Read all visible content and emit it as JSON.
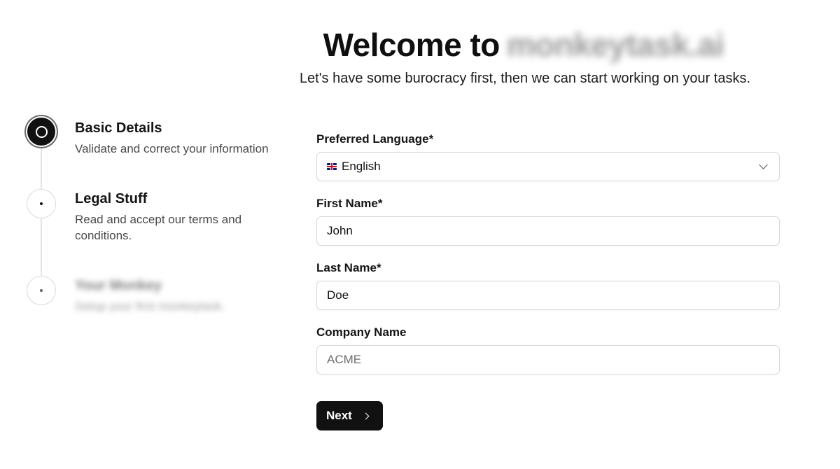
{
  "header": {
    "title_prefix": "Welcome to",
    "title_brand": "monkeytask.ai",
    "subtitle": "Let's have some burocracy first, then we can start working on your tasks."
  },
  "steps": [
    {
      "title": "Basic Details",
      "description": "Validate and correct your information",
      "state": "active"
    },
    {
      "title": "Legal Stuff",
      "description": "Read and accept our terms and conditions.",
      "state": "upcoming"
    },
    {
      "title": "Your Monkey",
      "description": "Setup your first monkeytask.",
      "state": "upcoming"
    }
  ],
  "form": {
    "language": {
      "label": "Preferred Language*",
      "value": "English",
      "flag": "uk-flag-icon"
    },
    "first_name": {
      "label": "First Name*",
      "value": "John"
    },
    "last_name": {
      "label": "Last Name*",
      "value": "Doe"
    },
    "company": {
      "label": "Company Name",
      "value": "",
      "placeholder": "ACME"
    }
  },
  "actions": {
    "next_label": "Next"
  },
  "colors": {
    "primary": "#111111",
    "border": "#d8d8dc",
    "connector": "#e4e4e7"
  }
}
